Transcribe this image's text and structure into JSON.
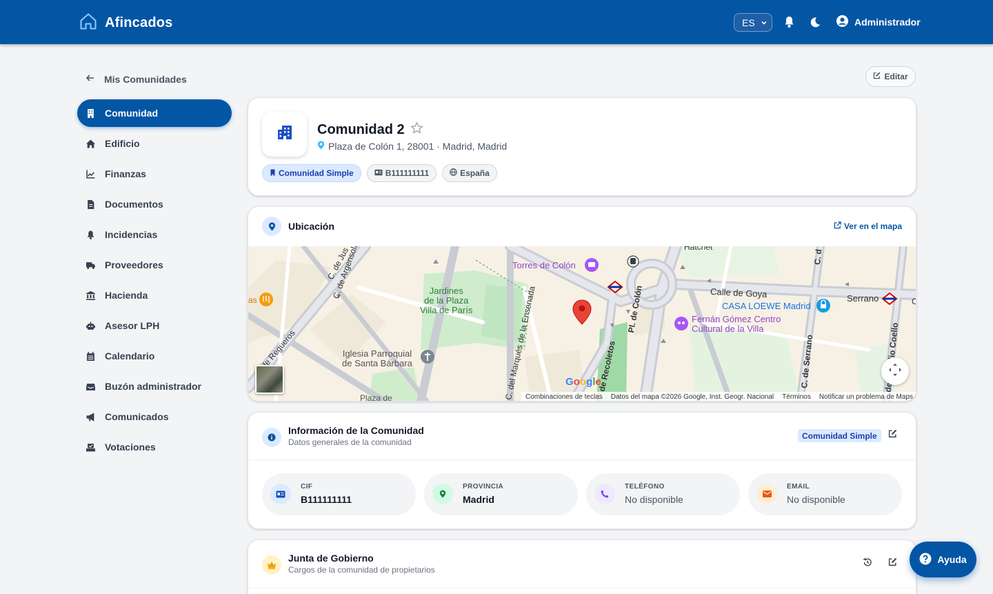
{
  "app": {
    "brand": "Afincados",
    "brand_icon": "home-icon"
  },
  "topbar": {
    "language": "ES",
    "user_name": "Administrador"
  },
  "sidebar": {
    "back_label": "Mis Comunidades",
    "items": [
      {
        "label": "Comunidad",
        "icon": "building-icon",
        "active": true
      },
      {
        "label": "Edificio",
        "icon": "home-icon"
      },
      {
        "label": "Finanzas",
        "icon": "chart-line-icon"
      },
      {
        "label": "Documentos",
        "icon": "file-icon"
      },
      {
        "label": "Incidencias",
        "icon": "bell-icon"
      },
      {
        "label": "Proveedores",
        "icon": "truck-icon"
      },
      {
        "label": "Hacienda",
        "icon": "bank-icon"
      },
      {
        "label": "Asesor LPH",
        "icon": "robot-icon"
      },
      {
        "label": "Calendario",
        "icon": "calendar-icon"
      },
      {
        "label": "Buzón administrador",
        "icon": "inbox-icon"
      },
      {
        "label": "Comunicados",
        "icon": "megaphone-icon"
      },
      {
        "label": "Votaciones",
        "icon": "ballot-icon"
      }
    ]
  },
  "page": {
    "edit_label": "Editar"
  },
  "community": {
    "name": "Comunidad 2",
    "address": "Plaza de Colón 1, 28001 · Madrid, Madrid",
    "chips": {
      "type": "Comunidad Simple",
      "cif": "B111111111",
      "country": "España"
    }
  },
  "location": {
    "title": "Ubicación",
    "view_map_label": "Ver en el mapa",
    "map": {
      "places": {
        "torres": "Torres de Colón",
        "jardines": "Jardines\nde la Plaza\nVilla de París",
        "iglesia": "Iglesia Parroquial\nde Santa Bárbara",
        "loewe": "CASA LOEWE Madrid",
        "fernan": "Fernán Gómez Centro\nCultural de la Villa",
        "goya": "Calle de Goya",
        "serrano_metro": "Serrano",
        "argensola": "C. de Argensola",
        "jus": "C. de Jus",
        "ensenada": "C. del Marqués de la Ensenada",
        "plcolon": "Pl. de Colón",
        "serrano_st": "C. de Serrano",
        "coello": "C. de Claudio Coello",
        "regueros": "C. de Regueros",
        "recoletos": "P.º de Recoletos",
        "plaza_de": "Plaza de",
        "as": "as",
        "top_c_d": "C. d",
        "top_hatchet": "Hatchet",
        "right_c": "C"
      },
      "google": "Google",
      "footer": {
        "shortcuts": "Combinaciones de teclas",
        "data": "Datos del mapa ©2026 Google, Inst. Geogr. Nacional",
        "terms": "Términos",
        "report": "Notificar un problema de Maps"
      }
    }
  },
  "info": {
    "title": "Información de la Comunidad",
    "subtitle": "Datos generales de la comunidad",
    "badge": "Comunidad Simple",
    "fields": {
      "cif": {
        "label": "CIF",
        "value": "B111111111"
      },
      "provincia": {
        "label": "PROVINCIA",
        "value": "Madrid"
      },
      "telefono": {
        "label": "TELÉFONO",
        "value": "No disponible"
      },
      "email": {
        "label": "EMAIL",
        "value": "No disponible"
      }
    }
  },
  "junta": {
    "title": "Junta de Gobierno",
    "subtitle": "Cargos de la comunidad de propietarios"
  },
  "help": {
    "label": "Ayuda"
  },
  "colors": {
    "primary": "#0356a4",
    "background": "#f3f4f6",
    "chip_blue_bg": "#dbeafe",
    "marker_red": "#ea4335"
  }
}
